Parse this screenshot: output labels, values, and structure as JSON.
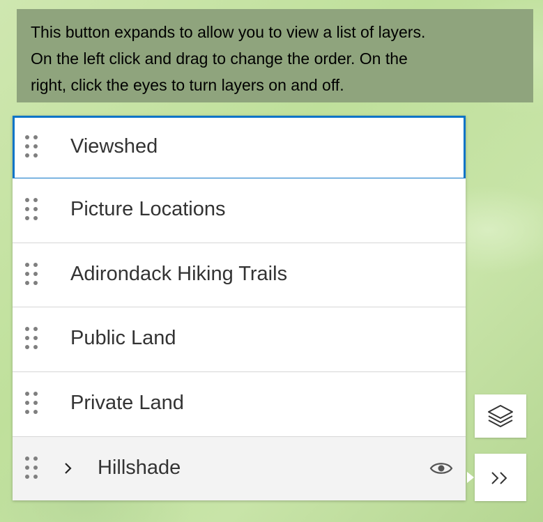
{
  "tooltip": {
    "line1": "This button expands to allow you to view a list of layers.",
    "line2": "On the left click and drag to change the order. On the",
    "line3": "right, click the eyes to turn layers on and off."
  },
  "layers": [
    {
      "label": "Viewshed",
      "selected": true
    },
    {
      "label": "Picture Locations",
      "selected": false
    },
    {
      "label": "Adirondack Hiking Trails",
      "selected": false
    },
    {
      "label": "Public Land",
      "selected": false
    },
    {
      "label": "Private Land",
      "selected": false
    },
    {
      "label": "Hillshade",
      "selected": false,
      "expandable": true,
      "visible": true
    }
  ],
  "icons": {
    "drag": "drag-handle-icon",
    "expand": "chevron-right-icon",
    "visibility": "eye-icon",
    "layers_tool": "layers-icon",
    "expand_tool": "double-chevron-right-icon"
  },
  "colors": {
    "selected_border": "#0a74c7",
    "tooltip_bg": "#8fa47d"
  }
}
